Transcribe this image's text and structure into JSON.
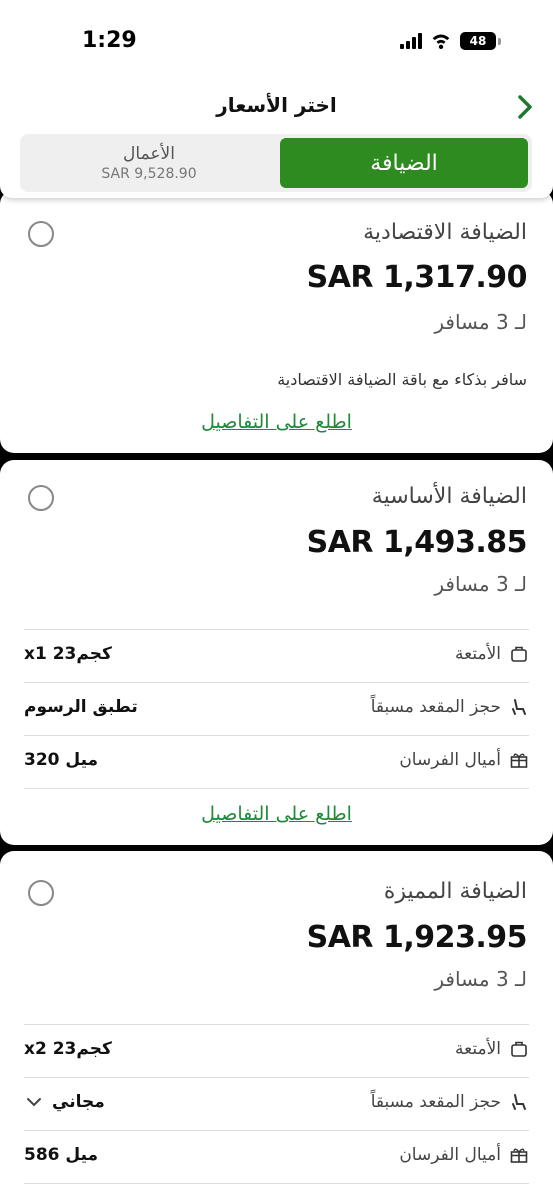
{
  "status_bar": {
    "time": "1:29",
    "battery": "48"
  },
  "header": {
    "title": "اختر الأسعار"
  },
  "segment": {
    "active_label": "الضيافة",
    "inactive_label": "الأعمال",
    "inactive_price": "SAR 9,528.90"
  },
  "fares": [
    {
      "title": "الضيافة الاقتصادية",
      "price": "SAR 1,317.90",
      "passengers": "لـ 3 مسافر",
      "description": "سافر بذكاء مع باقة الضيافة الاقتصادية",
      "details_link": "اطلع على التفاصيل"
    },
    {
      "title": "الضيافة الأساسية",
      "price": "SAR 1,493.85",
      "passengers": "لـ 3 مسافر",
      "rows": [
        {
          "icon": "luggage-icon",
          "label": "الأمتعة",
          "value": "x1 23كجم"
        },
        {
          "icon": "seat-icon",
          "label": "حجز المقعد مسبقاً",
          "value": "تطبق الرسوم"
        },
        {
          "icon": "gift-icon",
          "label": "أميال الفرسان",
          "value": "320 ميل"
        }
      ],
      "details_link": "اطلع على التفاصيل"
    },
    {
      "title": "الضيافة المميزة",
      "price": "SAR 1,923.95",
      "passengers": "لـ 3 مسافر",
      "rows": [
        {
          "icon": "luggage-icon",
          "label": "الأمتعة",
          "value": "x2 23كجم"
        },
        {
          "icon": "seat-icon",
          "label": "حجز المقعد مسبقاً",
          "value": "مجاني"
        },
        {
          "icon": "gift-icon",
          "label": "أميال الفرسان",
          "value": "586 ميل"
        }
      ]
    }
  ],
  "colors": {
    "accent": "#2e8b1f",
    "link": "#1f8a3a"
  }
}
